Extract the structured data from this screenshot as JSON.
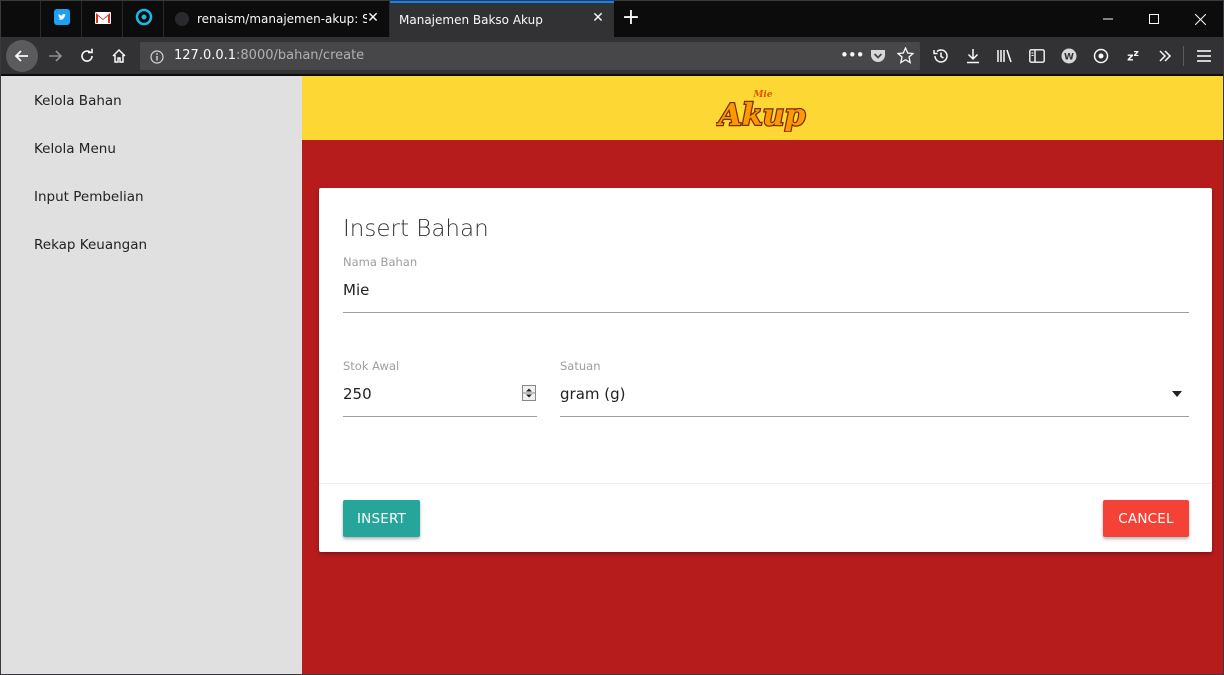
{
  "browser": {
    "tabs": [
      {
        "title": "renaism/manajemen-akup: Sist",
        "active": false
      },
      {
        "title": "Manajemen Bakso Akup",
        "active": true
      }
    ],
    "pinned_tabs": [
      "twitter-icon",
      "gmail-icon",
      "circle-app-icon"
    ],
    "url_host": "127.0.0.1",
    "url_rest": ":8000/bahan/create",
    "toolbar_icons": [
      "page-actions-icon",
      "pocket-icon",
      "bookmark-star-icon",
      "history-icon",
      "download-icon",
      "library-icon",
      "sidebar-icon",
      "extension-w-icon",
      "extension-evernote-icon",
      "extension-zz-icon",
      "overflow-icon",
      "menu-icon"
    ]
  },
  "sidebar": {
    "items": [
      {
        "label": "Kelola Bahan"
      },
      {
        "label": "Kelola Menu"
      },
      {
        "label": "Input Pembelian"
      },
      {
        "label": "Rekap Keuangan"
      }
    ]
  },
  "header": {
    "logo_text": "Akup",
    "logo_small_text": "Mie"
  },
  "form": {
    "title": "Insert Bahan",
    "nama_label": "Nama Bahan",
    "nama_value": "Mie",
    "stok_label": "Stok Awal",
    "stok_value": "250",
    "satuan_label": "Satuan",
    "satuan_value": "gram (g)",
    "insert_label": "INSERT",
    "cancel_label": "CANCEL"
  },
  "colors": {
    "header": "#fdd835",
    "background": "#b71c1c",
    "sidebar": "#e0e0e0",
    "insert": "#26a69a",
    "cancel": "#f44336"
  }
}
